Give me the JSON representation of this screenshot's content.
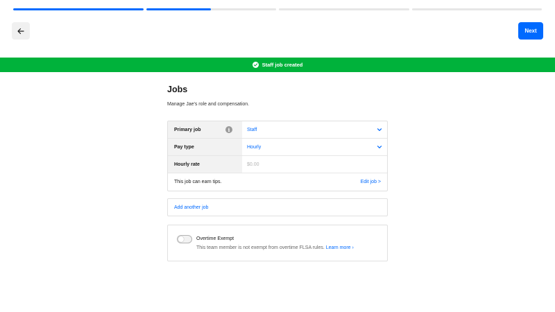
{
  "progress": {
    "steps": [
      1.0,
      0.5,
      0.0,
      0.0
    ]
  },
  "header": {
    "back_icon": "arrow-left-icon",
    "next_label": "Next"
  },
  "banner": {
    "icon": "check-circle-icon",
    "message": "Staff job created",
    "color": "#00b23b"
  },
  "main": {
    "title": "Jobs",
    "subtitle": "Manage Jae's role and compensation."
  },
  "jobs": {
    "rows": [
      {
        "label": "Primary job",
        "value": "Staff"
      },
      {
        "label": "Pay type",
        "value": "Hourly"
      },
      {
        "label": "Hourly rate",
        "placeholder": "$0.00"
      }
    ],
    "tips_text": "This job can earn tips.",
    "edit_link": "Edit job >"
  },
  "add_job_label": "Add another job",
  "overtime": {
    "title": "Overtime Exempt",
    "description": "This team member is not exempt from overtime FLSA rules.",
    "learn_more": "Learn more ›",
    "enabled": false
  },
  "colors": {
    "accent": "#006aff",
    "success": "#00b23b"
  }
}
